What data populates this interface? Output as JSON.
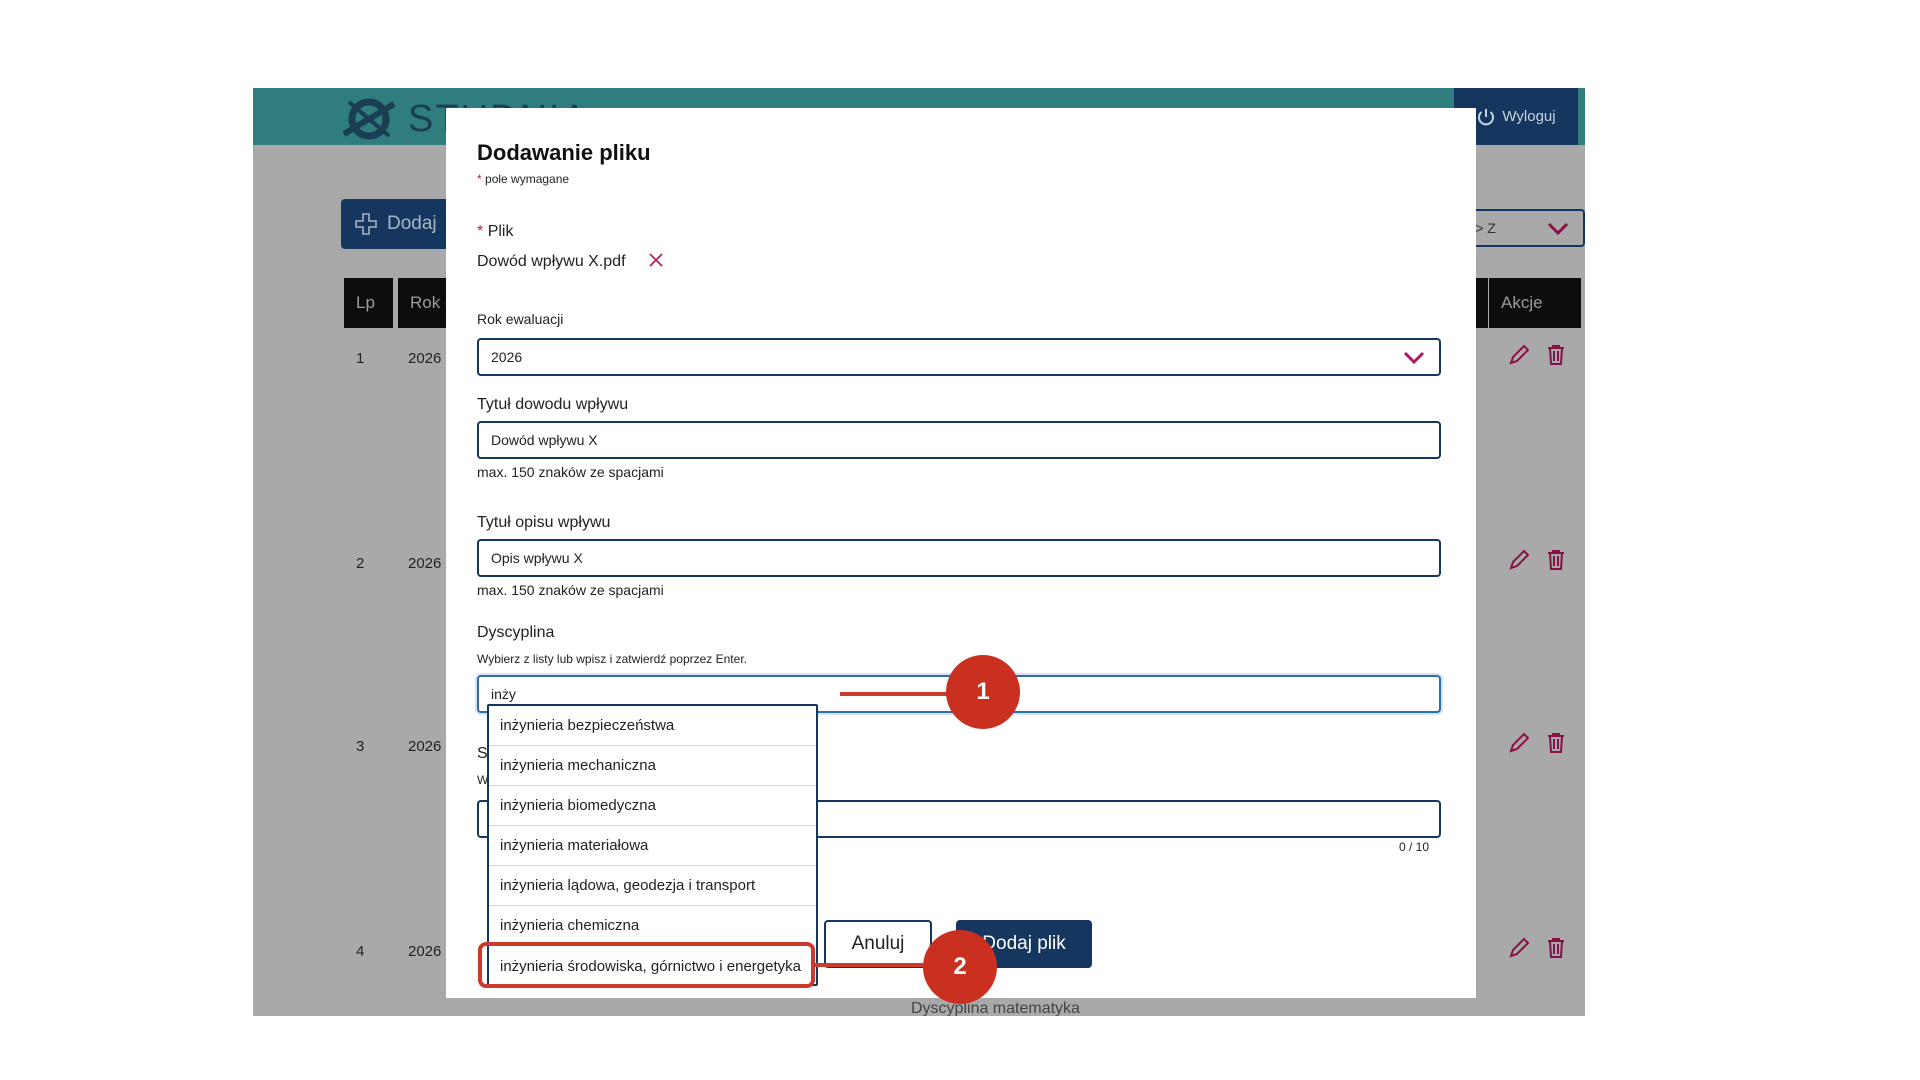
{
  "app": {
    "brand": "STUDNIA",
    "logout_label": "Wyloguj",
    "add_label": "Dodaj",
    "sort_label": "ku A > Z",
    "table_headers": {
      "lp": "Lp",
      "rok": "Rok e",
      "akcje": "Akcje"
    },
    "rows": [
      {
        "num": "1",
        "year": "2026"
      },
      {
        "num": "2",
        "year": "2026"
      },
      {
        "num": "3",
        "year": "2026"
      },
      {
        "num": "4",
        "year": "2026"
      }
    ],
    "bottom_text": "Dyscyplina   matematyka"
  },
  "modal": {
    "title": "Dodawanie pliku",
    "required_star": "*",
    "required_note": "pole wymagane",
    "file_label": "Plik",
    "file_name": "Dowód wpływu X.pdf",
    "year_label": "Rok ewaluacji",
    "year_value": "2026",
    "evidence_title_label": "Tytuł dowodu wpływu",
    "evidence_title_value": "Dowód wpływu X",
    "evidence_hint": "max. 150 znaków ze spacjami",
    "desc_title_label": "Tytuł opisu wpływu",
    "desc_title_value": "Opis wpływu X",
    "desc_hint": "max. 150 znaków ze spacjami",
    "discipline_label": "Dyscyplina",
    "discipline_hint": "Wybierz z listy lub wpisz i zatwierdź poprzez Enter.",
    "discipline_value": "inży",
    "hidden_label_start": "S",
    "hidden_hint_start": "W",
    "counter": "0 / 10",
    "cancel_label": "Anuluj",
    "submit_label": "Dodaj plik",
    "options": [
      "inżynieria bezpieczeństwa",
      "inżynieria mechaniczna",
      "inżynieria biomedyczna",
      "inżynieria materiałowa",
      "inżynieria lądowa, geodezja i transport",
      "inżynieria chemiczna",
      "inżynieria środowiska, górnictwo i energetyka"
    ]
  },
  "annotations": {
    "badge1": "1",
    "badge2": "2",
    "color": "#cc3a2b"
  }
}
